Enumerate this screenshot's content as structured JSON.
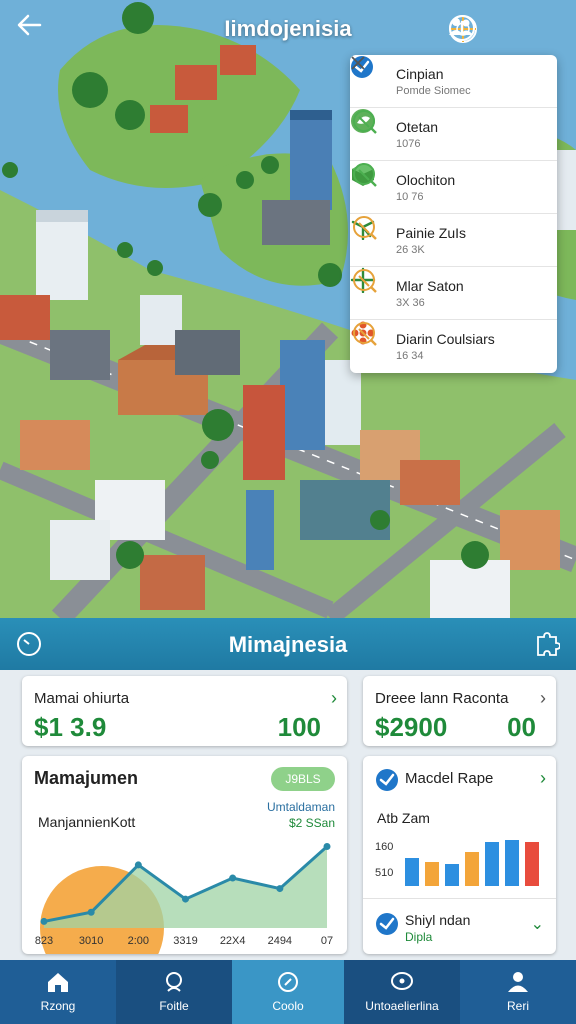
{
  "header": {
    "title": "Iimdojenisia"
  },
  "panel": {
    "items": [
      {
        "title": "Cinpian",
        "subtitle": "Pomde Siomec",
        "icon": "check-badge-icon",
        "action": "close-icon"
      },
      {
        "title": "Otetan",
        "subtitle": "1076",
        "icon": "leaf-icon",
        "action": "magnifier-icon"
      },
      {
        "title": "Olochiton",
        "subtitle": "10 76",
        "icon": "cube-icon",
        "action": "magnifier-icon"
      },
      {
        "title": "Painie ZuIs",
        "subtitle": "26 3K",
        "icon": "wind-turbine-icon",
        "action": "magnifier-icon"
      },
      {
        "title": "Mlar Saton",
        "subtitle": "3X 36",
        "icon": "wind-turbine-icon",
        "action": "magnifier-icon"
      },
      {
        "title": "Diarin Coulsiars",
        "subtitle": "16 34",
        "icon": "flower-icon",
        "action": "magnifier-icon"
      }
    ]
  },
  "dashboard": {
    "title": "Mimajnesia",
    "stat1": {
      "label": "Mamai ohiurta",
      "value": "$1 3.9",
      "value2": "100"
    },
    "stat2": {
      "label": "Dreee lann Raconta",
      "value": "$2900",
      "value2": "00"
    },
    "chart_card": {
      "title": "Mamajumen",
      "badge": "J9BLS",
      "annotation1": "Umtaldaman",
      "annotation2": "$2 SSan",
      "subtitle": "ManjannienKott"
    },
    "side_card": {
      "title": "Macdel Rape",
      "sub": "Atb Zam",
      "footer_title": "Shiyl ndan",
      "footer_sub": "Dipla"
    }
  },
  "chart_data": [
    {
      "type": "area",
      "x": [
        "823",
        "3010",
        "2:00",
        "3319",
        "22X4",
        "2494",
        "07"
      ],
      "values": [
        5,
        12,
        48,
        22,
        38,
        30,
        62
      ],
      "ylim": [
        0,
        70
      ],
      "title": "",
      "xlabel": "",
      "ylabel": "",
      "colors": {
        "line": "#2a8aa8",
        "fill": "#9fd3a4"
      }
    },
    {
      "type": "bar",
      "yticks": [
        "160",
        "510"
      ],
      "values": [
        28,
        24,
        22,
        34,
        44,
        46,
        44
      ],
      "ylim": [
        0,
        50
      ],
      "colors": [
        "#2d8fe0",
        "#f3a53a",
        "#2d8fe0",
        "#f3a53a",
        "#2d8fe0",
        "#2d8fe0",
        "#e84c3d"
      ]
    }
  ],
  "bottom_nav": [
    {
      "label": "Rzong",
      "icon": "home-icon"
    },
    {
      "label": "Foitle",
      "icon": "location-icon"
    },
    {
      "label": "Coolo",
      "icon": "compass-icon"
    },
    {
      "label": "Untoaelierlina",
      "icon": "chat-icon"
    },
    {
      "label": "Reri",
      "icon": "profile-icon"
    }
  ]
}
